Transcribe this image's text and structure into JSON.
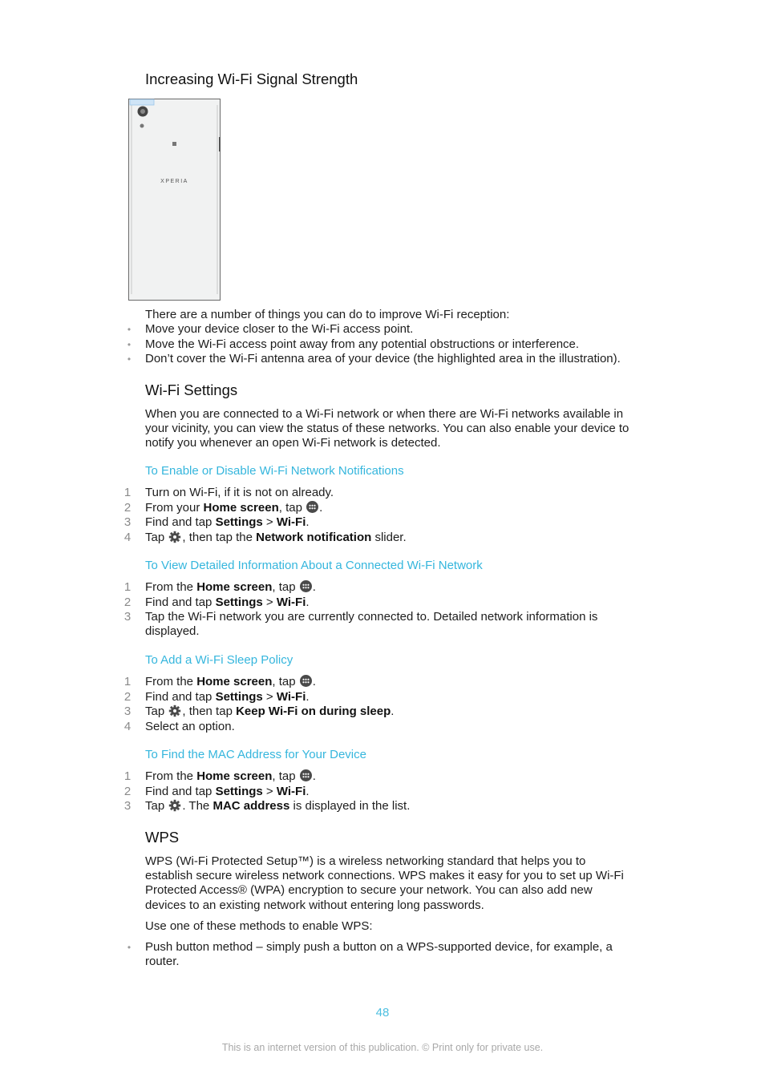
{
  "sections": {
    "signal": {
      "title": "Increasing Wi-Fi Signal Strength",
      "illustration": {
        "brand_text": "XPERIA",
        "highlight_color": "#bcdcf4"
      },
      "intro": "There are a number of things you can do to improve Wi-Fi reception:",
      "bullets": [
        "Move your device closer to the Wi-Fi access point.",
        "Move the Wi-Fi access point away from any potential obstructions or interference.",
        "Don’t cover the Wi-Fi antenna area of your device (the highlighted area in the illustration)."
      ]
    },
    "wifi_settings": {
      "title": "Wi-Fi Settings",
      "intro": "When you are connected to a Wi-Fi network or when there are Wi-Fi networks available in your vicinity, you can view the status of these networks. You can also enable your device to notify you whenever an open Wi-Fi network is detected."
    },
    "notifications": {
      "title": "To Enable or Disable Wi-Fi Network Notifications",
      "steps": [
        {
          "num": "1",
          "parts": [
            {
              "t": "Turn on Wi-Fi, if it is not on already."
            }
          ]
        },
        {
          "num": "2",
          "parts": [
            {
              "t": "From your "
            },
            {
              "b": "Home screen"
            },
            {
              "t": ", tap "
            },
            {
              "icon": "apps-icon"
            },
            {
              "t": "."
            }
          ]
        },
        {
          "num": "3",
          "parts": [
            {
              "t": "Find and tap "
            },
            {
              "b": "Settings"
            },
            {
              "t": " > "
            },
            {
              "b": "Wi-Fi"
            },
            {
              "t": "."
            }
          ]
        },
        {
          "num": "4",
          "parts": [
            {
              "t": "Tap "
            },
            {
              "icon": "gear-icon"
            },
            {
              "t": ", then tap the "
            },
            {
              "b": "Network notification"
            },
            {
              "t": " slider."
            }
          ]
        }
      ]
    },
    "detailed_info": {
      "title": "To View Detailed Information About a Connected Wi-Fi Network",
      "steps": [
        {
          "num": "1",
          "parts": [
            {
              "t": "From the "
            },
            {
              "b": "Home screen"
            },
            {
              "t": ", tap "
            },
            {
              "icon": "apps-icon"
            },
            {
              "t": "."
            }
          ]
        },
        {
          "num": "2",
          "parts": [
            {
              "t": "Find and tap "
            },
            {
              "b": "Settings"
            },
            {
              "t": " > "
            },
            {
              "b": "Wi-Fi"
            },
            {
              "t": "."
            }
          ]
        },
        {
          "num": "3",
          "parts": [
            {
              "t": "Tap the Wi-Fi network you are currently connected to. Detailed network information is displayed."
            }
          ]
        }
      ]
    },
    "sleep_policy": {
      "title": "To Add a Wi-Fi Sleep Policy",
      "steps": [
        {
          "num": "1",
          "parts": [
            {
              "t": "From the "
            },
            {
              "b": "Home screen"
            },
            {
              "t": ", tap "
            },
            {
              "icon": "apps-icon"
            },
            {
              "t": "."
            }
          ]
        },
        {
          "num": "2",
          "parts": [
            {
              "t": "Find and tap "
            },
            {
              "b": "Settings"
            },
            {
              "t": " > "
            },
            {
              "b": "Wi-Fi"
            },
            {
              "t": "."
            }
          ]
        },
        {
          "num": "3",
          "parts": [
            {
              "t": "Tap "
            },
            {
              "icon": "gear-icon"
            },
            {
              "t": ", then tap "
            },
            {
              "b": "Keep Wi-Fi on during sleep"
            },
            {
              "t": "."
            }
          ]
        },
        {
          "num": "4",
          "parts": [
            {
              "t": "Select an option."
            }
          ]
        }
      ]
    },
    "mac_address": {
      "title": "To Find the MAC Address for Your Device",
      "steps": [
        {
          "num": "1",
          "parts": [
            {
              "t": "From the "
            },
            {
              "b": "Home screen"
            },
            {
              "t": ", tap "
            },
            {
              "icon": "apps-icon"
            },
            {
              "t": "."
            }
          ]
        },
        {
          "num": "2",
          "parts": [
            {
              "t": "Find and tap "
            },
            {
              "b": "Settings"
            },
            {
              "t": " > "
            },
            {
              "b": "Wi-Fi"
            },
            {
              "t": "."
            }
          ]
        },
        {
          "num": "3",
          "parts": [
            {
              "t": "Tap "
            },
            {
              "icon": "gear-icon"
            },
            {
              "t": ". The "
            },
            {
              "b": "MAC address"
            },
            {
              "t": " is displayed in the list."
            }
          ]
        }
      ]
    },
    "wps": {
      "title": "WPS",
      "intro": "WPS (Wi-Fi Protected Setup™) is a wireless networking standard that helps you to establish secure wireless network connections. WPS makes it easy for you to set up Wi-Fi Protected Access® (WPA) encryption to secure your network. You can also add new devices to an existing network without entering long passwords.",
      "methods_intro": "Use one of these methods to enable WPS:",
      "bullets": [
        "Push button method – simply push a button on a WPS-supported device, for example, a router."
      ]
    }
  },
  "footer": {
    "page_number": "48",
    "notice": "This is an internet version of this publication. © Print only for private use."
  },
  "colors": {
    "accent": "#35b6dd",
    "body_text": "#1d1d1d",
    "footer_text": "#a8a8a8"
  }
}
